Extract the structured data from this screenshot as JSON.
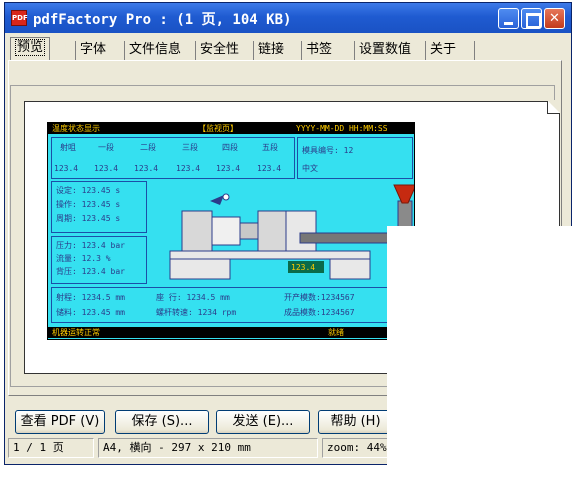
{
  "window": {
    "title": "pdfFactory Pro :  (1 页, 104 KB)",
    "app_icon": "pdf-app-icon",
    "app_icon_text": "PDF",
    "controls": [
      "minimize",
      "maximize",
      "close"
    ],
    "close_glyph": "✕"
  },
  "tabs": [
    {
      "label": "预览",
      "active": true
    },
    {
      "label": "字体"
    },
    {
      "label": "文件信息"
    },
    {
      "label": "安全性"
    },
    {
      "label": "链接"
    },
    {
      "label": "书签"
    },
    {
      "label": "设置数值"
    },
    {
      "label": "关于"
    }
  ],
  "hmi": {
    "header": {
      "left": "温度状态显示",
      "center": "【监视页】",
      "right": "YYYY-MM-DD HH:MM:SS"
    },
    "zones": [
      "射咀",
      "一段",
      "二段",
      "三段",
      "四段",
      "五段"
    ],
    "zone_values": [
      "123.4",
      "123.4",
      "123.4",
      "123.4",
      "123.4",
      "123.4"
    ],
    "mold_no": "模具编号: 12",
    "mode": "中文",
    "times": [
      "设定: 123.45 s",
      "操作: 123.45 s",
      "周期: 123.45 s"
    ],
    "process": [
      "压力: 123.4 bar",
      "流量: 12.3 %",
      "背压: 123.4 bar"
    ],
    "display_value": "123.4",
    "bottom_row1": [
      "射程: 1234.5 mm",
      "座    行: 1234.5 mm",
      "开产模数:1234567"
    ],
    "bottom_row2": [
      "储料: 123.45 mm",
      "螺杆转速: 1234   rpm",
      "成品模数:1234567"
    ],
    "footer": {
      "left": "机器运转正常",
      "right": "就绪"
    }
  },
  "buttons": {
    "view_pdf": "查看 PDF (V)",
    "save": "保存 (S)...",
    "send": "发送 (E)...",
    "help": "帮助 (H)"
  },
  "status": {
    "page": "1 / 1 页",
    "paper": "A4, 横向 - 297 x 210 mm",
    "zoom": "zoom: 44%"
  },
  "colors": {
    "titlebar": "#1f5bd1",
    "hmi_background": "#35e0f0",
    "hmi_text": "#2b3b8a",
    "hmi_bar": "#000000",
    "hmi_bar_text": "#ffcc00",
    "close_button": "#c23a1b"
  }
}
